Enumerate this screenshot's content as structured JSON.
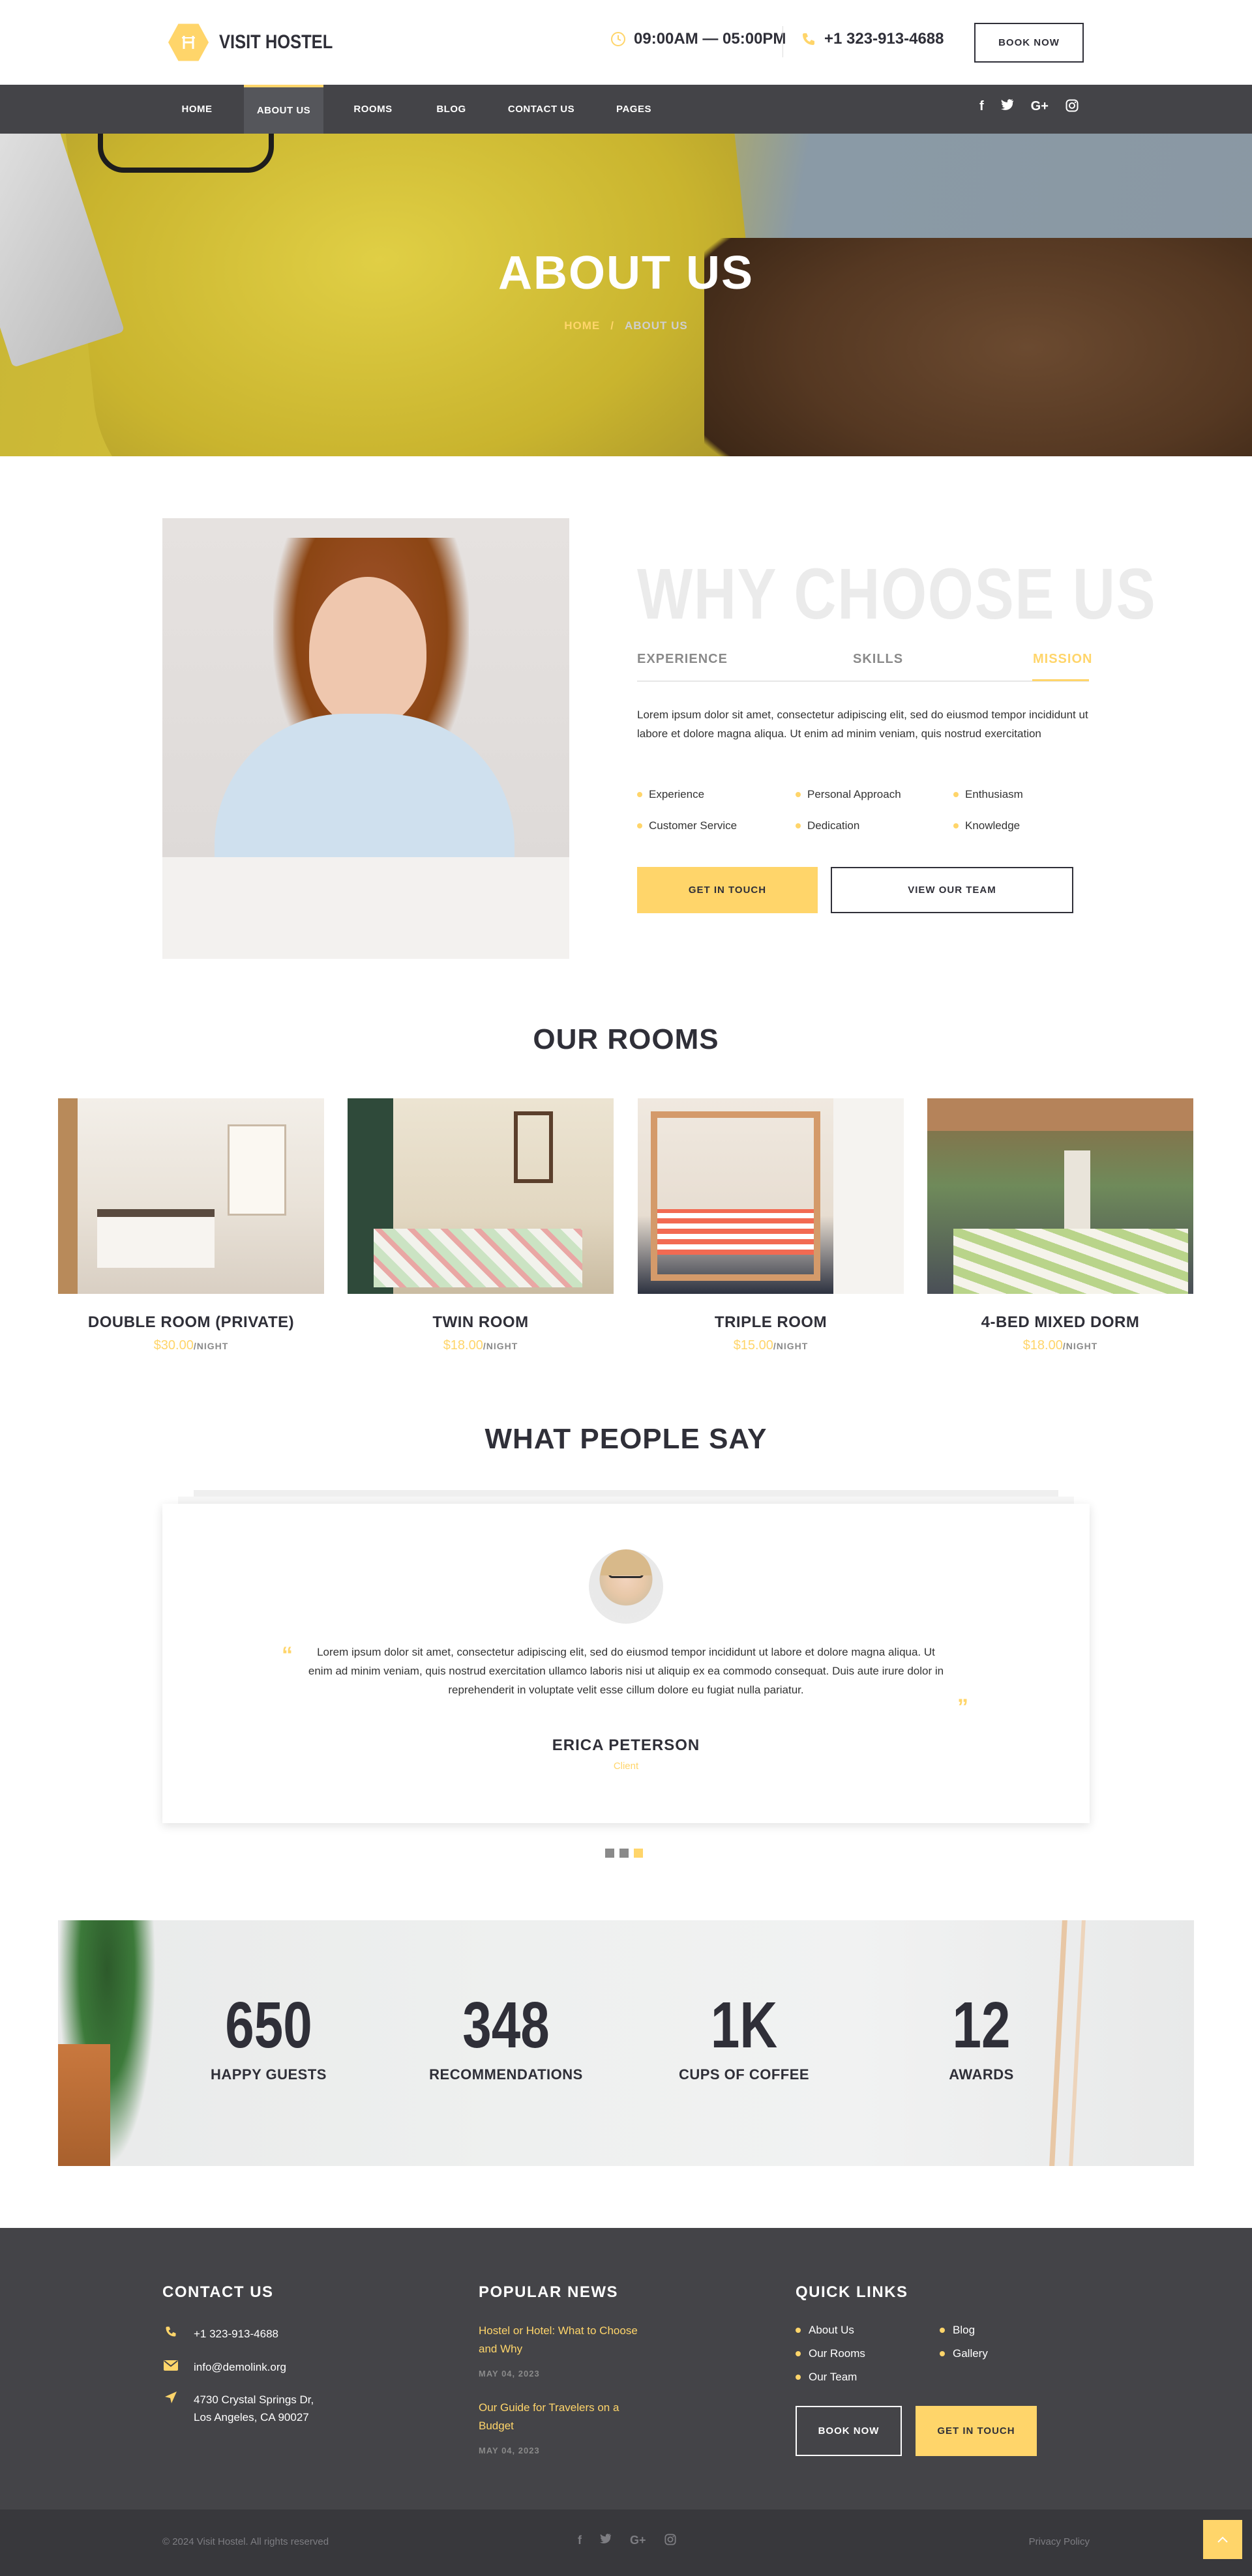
{
  "header": {
    "logo_text": "VISIT HOSTEL",
    "hours": "09:00AM — 05:00PM",
    "phone": "+1 323-913-4688",
    "book_now": "BOOK NOW"
  },
  "nav": {
    "items": [
      "HOME",
      "ABOUT US",
      "ROOMS",
      "BLOG",
      "CONTACT US",
      "PAGES"
    ],
    "active": "ABOUT US",
    "social": [
      "f",
      "t",
      "G+",
      "◎"
    ]
  },
  "hero": {
    "title": "ABOUT US",
    "crumb_home": "HOME",
    "crumb_sep": "/",
    "crumb_current": "ABOUT US"
  },
  "about": {
    "title": "WHY CHOOSE US",
    "tabs": [
      "EXPERIENCE",
      "SKILLS",
      "MISSION"
    ],
    "active_tab": "MISSION",
    "text": "Lorem ipsum dolor sit amet, consectetur adipiscing elit, sed do eiusmod tempor incididunt ut labore et dolore magna aliqua. Ut enim ad minim veniam, quis nostrud exercitation",
    "list": [
      "Experience",
      "Personal Approach",
      "Enthusiasm",
      "Customer Service",
      "Dedication",
      "Knowledge"
    ],
    "btn_primary": "GET IN TOUCH",
    "btn_secondary": "VIEW OUR TEAM"
  },
  "rooms": {
    "title": "OUR ROOMS",
    "items": [
      {
        "name": "DOUBLE ROOM (PRIVATE)",
        "price": "$30.00",
        "unit": "/NIGHT"
      },
      {
        "name": "TWIN ROOM",
        "price": "$18.00",
        "unit": "/NIGHT"
      },
      {
        "name": "TRIPLE ROOM",
        "price": "$15.00",
        "unit": "/NIGHT"
      },
      {
        "name": "4-BED MIXED DORM",
        "price": "$18.00",
        "unit": "/NIGHT"
      }
    ]
  },
  "testimonial": {
    "title": "WHAT PEOPLE SAY",
    "text": "Lorem ipsum dolor sit amet, consectetur adipiscing elit, sed do eiusmod tempor incididunt ut labore et dolore magna aliqua. Ut enim ad minim veniam, quis nostrud exercitation ullamco laboris nisi ut aliquip ex ea commodo consequat. Duis aute irure dolor in reprehenderit in voluptate velit esse cillum dolore eu fugiat nulla pariatur.",
    "name": "ERICA PETERSON",
    "role": "Client",
    "quote_open": "“",
    "quote_close": "”"
  },
  "stats": [
    {
      "value": "650",
      "label": "HAPPY GUESTS"
    },
    {
      "value": "348",
      "label": "RECOMMENDATIONS"
    },
    {
      "value": "1K",
      "label": "CUPS OF COFFEE"
    },
    {
      "value": "12",
      "label": "AWARDS"
    }
  ],
  "footer": {
    "contact_title": "CONTACT US",
    "phone": "+1 323-913-4688",
    "email": "info@demolink.org",
    "address_line1": "4730 Crystal Springs Dr,",
    "address_line2": "Los Angeles, CA 90027",
    "news_title": "POPULAR NEWS",
    "news": [
      {
        "title": "Hostel or Hotel: What to Choose and Why",
        "date": "MAY 04, 2023"
      },
      {
        "title": "Our Guide for Travelers on a Budget",
        "date": "MAY 04, 2023"
      }
    ],
    "links_title": "QUICK LINKS",
    "links_col1": [
      "About Us",
      "Our Rooms",
      "Our Team"
    ],
    "links_col2": [
      "Blog",
      "Gallery"
    ],
    "btn_book": "BOOK NOW",
    "btn_touch": "GET IN TOUCH"
  },
  "bottom": {
    "copyright": "© 2024 Visit Hostel. All rights reserved",
    "privacy": "Privacy Policy",
    "social": [
      "f",
      "t",
      "G+",
      "◎"
    ],
    "to_top": "^"
  },
  "colors": {
    "accent": "#ffd56a",
    "dark": "#444448",
    "text": "#2f2f38"
  }
}
